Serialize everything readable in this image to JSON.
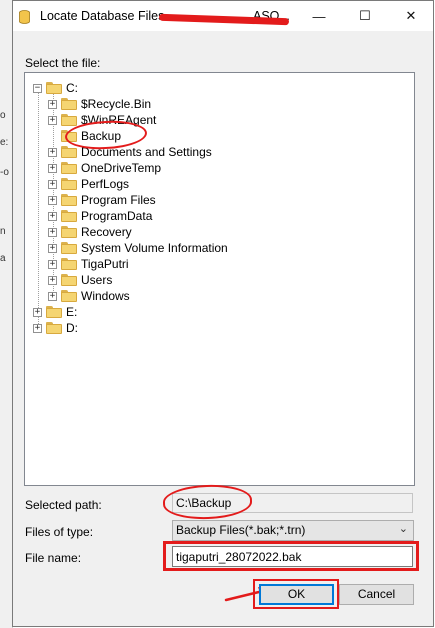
{
  "window": {
    "title": "Locate Database Files - ",
    "title_suffix": "ASQ...",
    "controls": {
      "minimize": "—",
      "maximize": "☐",
      "close": "✕"
    }
  },
  "background_app": {
    "fragments": [
      "o",
      "e:",
      "-o",
      "n",
      "a"
    ]
  },
  "tree_label": "Select the file:",
  "tree": {
    "root_c": "C:",
    "c_children": [
      "$Recycle.Bin",
      "$WinREAgent",
      "Backup",
      "Documents and Settings",
      "OneDriveTemp",
      "PerfLogs",
      "Program Files",
      "ProgramData",
      "Recovery",
      "System Volume Information",
      "TigaPutri",
      "Users",
      "Windows"
    ],
    "root_e": "E:",
    "root_d": "D:"
  },
  "form": {
    "selected_path_label": "Selected path:",
    "selected_path_value": "C:\\Backup",
    "files_of_type_label": "Files of type:",
    "files_of_type_value": "Backup Files(*.bak;*.trn)",
    "file_name_label": "File name:",
    "file_name_value": "tigaputri_28072022.bak"
  },
  "buttons": {
    "ok": "OK",
    "cancel": "Cancel"
  },
  "colors": {
    "annotation": "#e31b1b",
    "focus": "#0078d7",
    "folder": "#f5d572"
  }
}
